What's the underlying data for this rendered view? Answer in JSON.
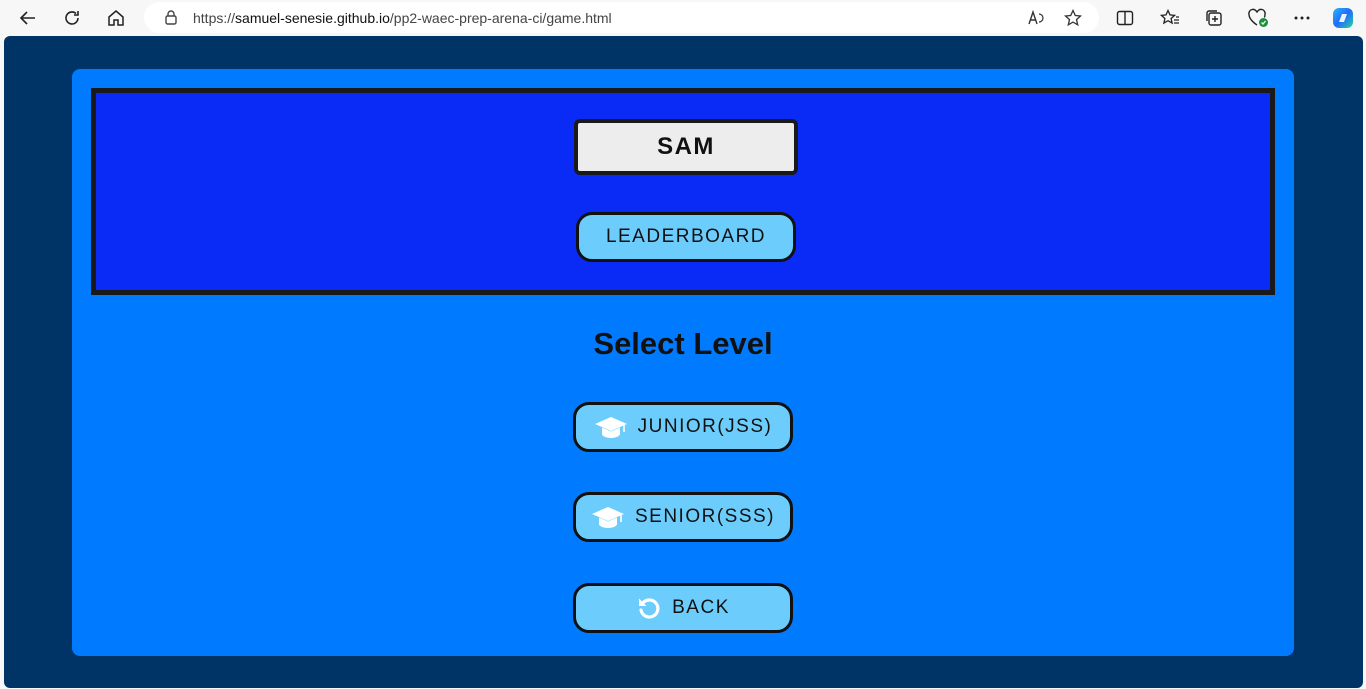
{
  "browser": {
    "url_scheme": "https://",
    "url_host": "samuel-senesie.github.io",
    "url_path": "/pp2-waec-prep-arena-ci/game.html"
  },
  "header": {
    "player_name": "SAM",
    "leaderboard_label": "LEADERBOARD"
  },
  "main": {
    "title": "Select Level",
    "junior_label": "JUNIOR(JSS)",
    "senior_label": "SENIOR(SSS)",
    "back_label": "BACK"
  },
  "colors": {
    "page_bg": "#003366",
    "card_bg": "#007bff",
    "panel_bg": "#0a2bf5",
    "button_bg": "#6ccdfc"
  },
  "icons": {
    "level_icon": "graduation-cap-icon",
    "back_icon": "rotate-left-icon"
  }
}
